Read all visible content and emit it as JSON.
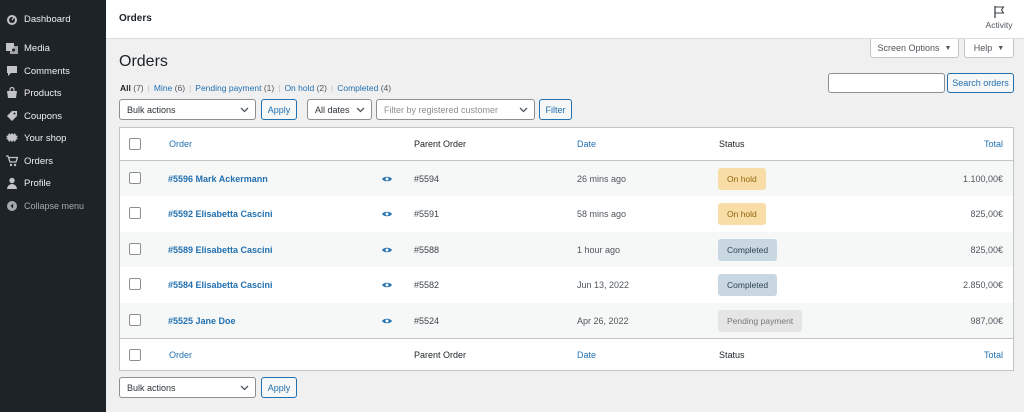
{
  "sidebar": {
    "items": [
      {
        "label": "Dashboard",
        "icon": "dashboard-icon"
      },
      {
        "label": "Media",
        "icon": "media-icon"
      },
      {
        "label": "Comments",
        "icon": "comments-icon"
      },
      {
        "label": "Products",
        "icon": "products-icon"
      },
      {
        "label": "Coupons",
        "icon": "coupons-icon"
      },
      {
        "label": "Your shop",
        "icon": "shop-icon"
      },
      {
        "label": "Orders",
        "icon": "cart-icon"
      },
      {
        "label": "Profile",
        "icon": "user-icon"
      },
      {
        "label": "Collapse menu",
        "icon": "collapse-icon"
      }
    ]
  },
  "topbar": {
    "title": "Orders",
    "activity_label": "Activity"
  },
  "screen_options": {
    "label": "Screen Options",
    "arrow": "▼"
  },
  "help": {
    "label": "Help",
    "arrow": "▼"
  },
  "page_title": "Orders",
  "views": [
    {
      "label": "All",
      "count": "(7)"
    },
    {
      "label": "Mine",
      "count": "(6)"
    },
    {
      "label": "Pending payment",
      "count": "(1)"
    },
    {
      "label": "On hold",
      "count": "(2)"
    },
    {
      "label": "Completed",
      "count": "(4)"
    }
  ],
  "filters": {
    "bulk_actions": "Bulk actions",
    "apply": "Apply",
    "dates": "All dates",
    "customer_placeholder": "Filter by registered customer",
    "filter": "Filter",
    "search_button": "Search orders"
  },
  "table": {
    "columns": {
      "order": "Order",
      "parent": "Parent Order",
      "date": "Date",
      "status": "Status",
      "total": "Total"
    },
    "rows": [
      {
        "order": "#5596 Mark Ackermann",
        "parent": "#5594",
        "date": "26 mins ago",
        "status": "On hold",
        "total": "1.100,00€"
      },
      {
        "order": "#5592 Elisabetta Cascini",
        "parent": "#5591",
        "date": "58 mins ago",
        "status": "On hold",
        "total": "825,00€"
      },
      {
        "order": "#5589 Elisabetta Cascini",
        "parent": "#5588",
        "date": "1 hour ago",
        "status": "Completed",
        "total": "825,00€"
      },
      {
        "order": "#5584 Elisabetta Cascini",
        "parent": "#5582",
        "date": "Jun 13, 2022",
        "status": "Completed",
        "total": "2.850,00€"
      },
      {
        "order": "#5525 Jane Doe",
        "parent": "#5524",
        "date": "Apr 26, 2022",
        "status": "Pending payment",
        "total": "987,00€"
      }
    ]
  },
  "bottom": {
    "bulk_actions": "Bulk actions",
    "apply": "Apply"
  },
  "status_colors": {
    "on_hold": {
      "bg": "#f8dda7",
      "fg": "#94660c"
    },
    "completed": {
      "bg": "#c8d7e1",
      "fg": "#2e4453"
    },
    "pending": {
      "bg": "#e5e5e5",
      "fg": "#777777"
    }
  }
}
